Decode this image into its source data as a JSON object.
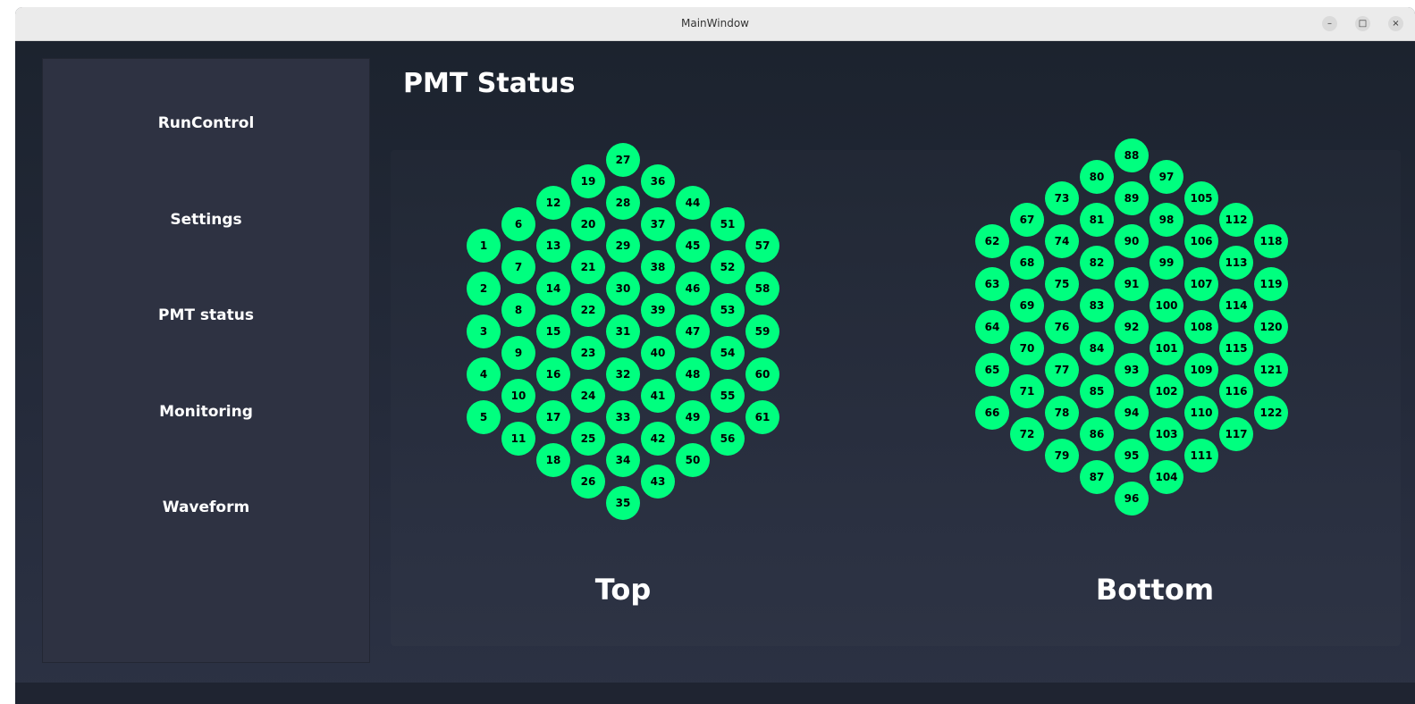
{
  "window": {
    "title": "MainWindow",
    "controls": {
      "minimize": "–",
      "maximize": "□",
      "close": "×"
    }
  },
  "sidebar": {
    "items": [
      {
        "label": "RunControl"
      },
      {
        "label": "Settings"
      },
      {
        "label": "PMT status"
      },
      {
        "label": "Monitoring"
      },
      {
        "label": "Waveform"
      }
    ]
  },
  "page": {
    "title": "PMT Status"
  },
  "pmt_status": {
    "status_color": "#00ff7f",
    "groups": [
      {
        "label": "Top",
        "columns": [
          [
            1,
            2,
            3,
            4,
            5
          ],
          [
            6,
            7,
            8,
            9,
            10,
            11
          ],
          [
            12,
            13,
            14,
            15,
            16,
            17,
            18
          ],
          [
            19,
            20,
            21,
            22,
            23,
            24,
            25,
            26
          ],
          [
            27,
            28,
            29,
            30,
            31,
            32,
            33,
            34,
            35
          ],
          [
            36,
            37,
            38,
            39,
            40,
            41,
            42,
            43
          ],
          [
            44,
            45,
            46,
            47,
            48,
            49,
            50
          ],
          [
            51,
            52,
            53,
            54,
            55,
            56
          ],
          [
            57,
            58,
            59,
            60,
            61
          ]
        ]
      },
      {
        "label": "Bottom",
        "columns": [
          [
            62,
            63,
            64,
            65,
            66
          ],
          [
            67,
            68,
            69,
            70,
            71,
            72
          ],
          [
            73,
            74,
            75,
            76,
            77,
            78,
            79
          ],
          [
            80,
            81,
            82,
            83,
            84,
            85,
            86,
            87
          ],
          [
            88,
            89,
            90,
            91,
            92,
            93,
            94,
            95,
            96
          ],
          [
            97,
            98,
            99,
            100,
            101,
            102,
            103,
            104
          ],
          [
            105,
            106,
            107,
            108,
            109,
            110,
            111
          ],
          [
            112,
            113,
            114,
            115,
            116,
            117
          ],
          [
            118,
            119,
            120,
            121,
            122
          ]
        ]
      }
    ]
  }
}
